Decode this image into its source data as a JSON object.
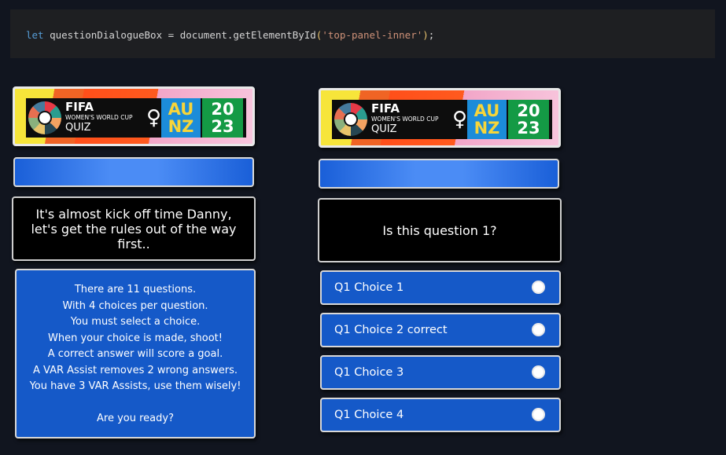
{
  "code": {
    "keyword": "let",
    "var_name": "questionDialogueBox",
    "eq": "=",
    "call": "document.getElementById",
    "open": "(",
    "arg": "'top-panel-inner'",
    "close": ")",
    "semi": ";"
  },
  "banner": {
    "line1": "FIFA",
    "line2": "WOMEN'S WORLD CUP",
    "line3": "QUIZ",
    "au_top": "AU",
    "au_bottom": "NZ",
    "yr_top": "20",
    "yr_bottom": "23",
    "trophy_icon": "trophy-icon"
  },
  "left_panel": {
    "welcome": "It's almost kick off time Danny, let's get the rules out of the way first..",
    "rules": [
      "There are 11 questions.",
      "With 4 choices per question.",
      "You must select a choice.",
      "When your choice is made, shoot!",
      "A correct answer will score a goal.",
      "A VAR Assist removes 2 wrong answers.",
      "You have 3 VAR Assists, use them wisely!",
      "",
      "Are you ready?"
    ]
  },
  "right_panel": {
    "question": "Is this question 1?",
    "choices": [
      {
        "label": "Q1 Choice 1"
      },
      {
        "label": "Q1 Choice 2 correct"
      },
      {
        "label": "Q1 Choice 3"
      },
      {
        "label": "Q1 Choice 4"
      }
    ]
  },
  "colors": {
    "page_bg": "#11151f",
    "panel_blue": "#1559c8",
    "bar_blue": "#4b8cf5"
  }
}
